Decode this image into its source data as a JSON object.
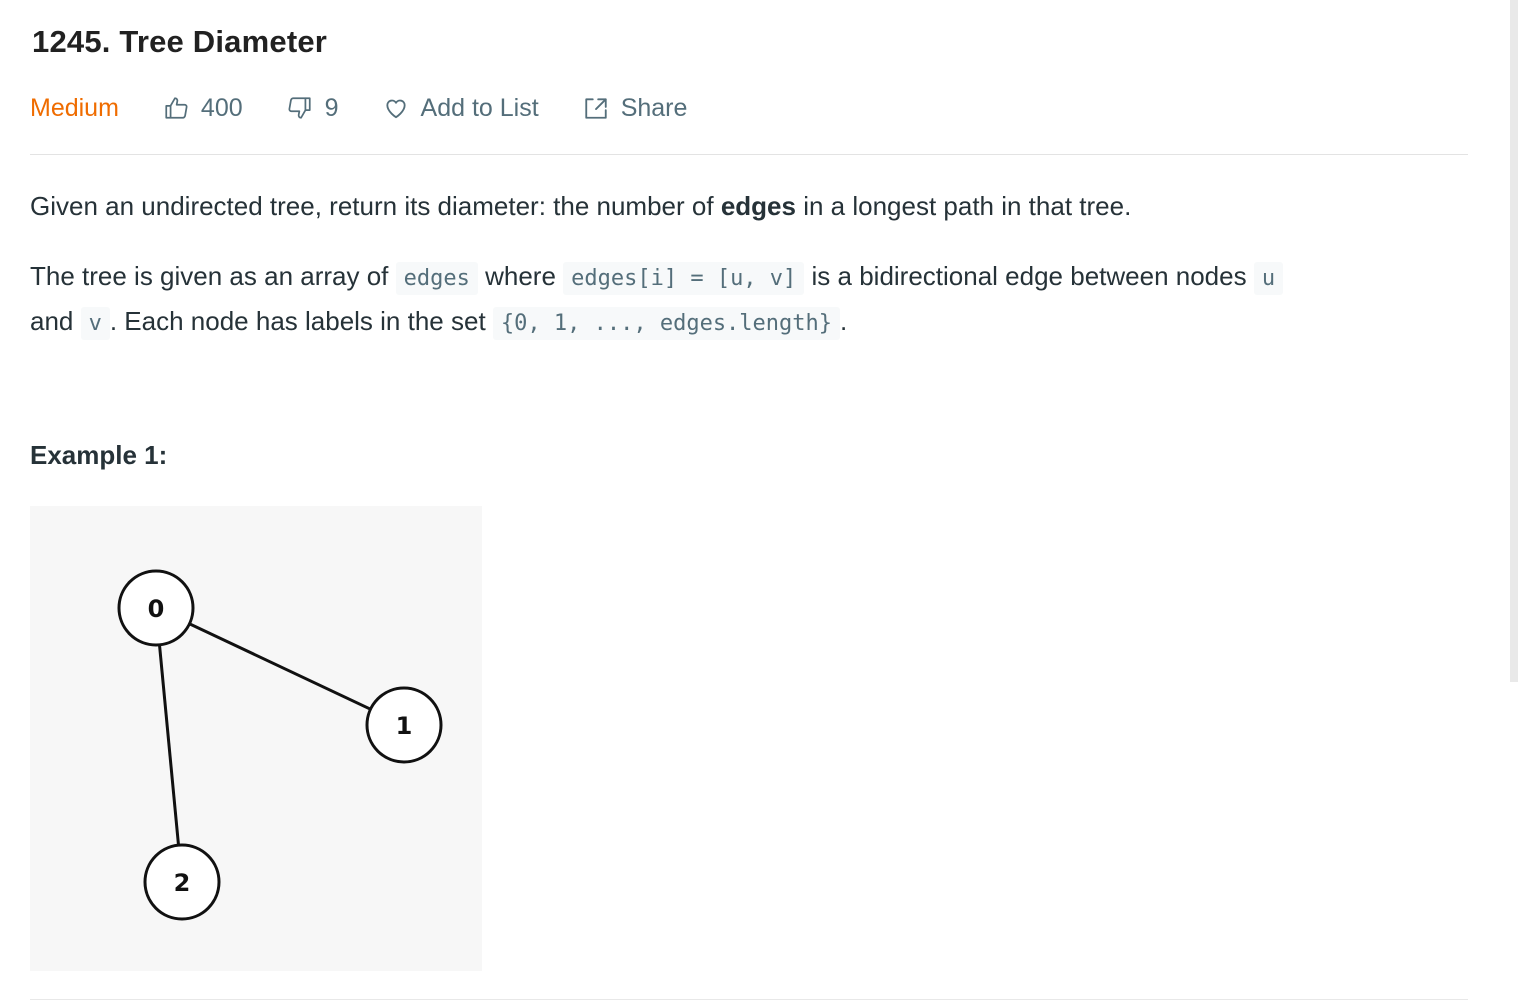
{
  "problem": {
    "title": "1245. Tree Diameter",
    "difficulty": "Medium",
    "likes": "400",
    "dislikes": "9",
    "add_to_list": "Add to List",
    "share": "Share"
  },
  "description": {
    "p1_a": "Given an undirected tree, return its diameter: the number of ",
    "p1_b": "edges",
    "p1_c": " in a longest path in that tree.",
    "p2_a": "The tree is given as an array of ",
    "p2_code1": "edges",
    "p2_b": " where ",
    "p2_code2": "edges[i] = [u, v]",
    "p2_c": " is a bidirectional edge between nodes ",
    "p2_code3": "u",
    "p2_d": " and ",
    "p2_code4": "v",
    "p2_e": ".  Each node has labels in the set ",
    "p2_code5": "{0, 1, ..., edges.length}",
    "p2_f": "."
  },
  "example": {
    "title": "Example 1:",
    "nodes": [
      "0",
      "1",
      "2"
    ]
  },
  "colors": {
    "difficulty_medium": "#ef6c00",
    "text": "#263238",
    "muted": "#546e7a",
    "code_bg": "#f7f9fa"
  }
}
